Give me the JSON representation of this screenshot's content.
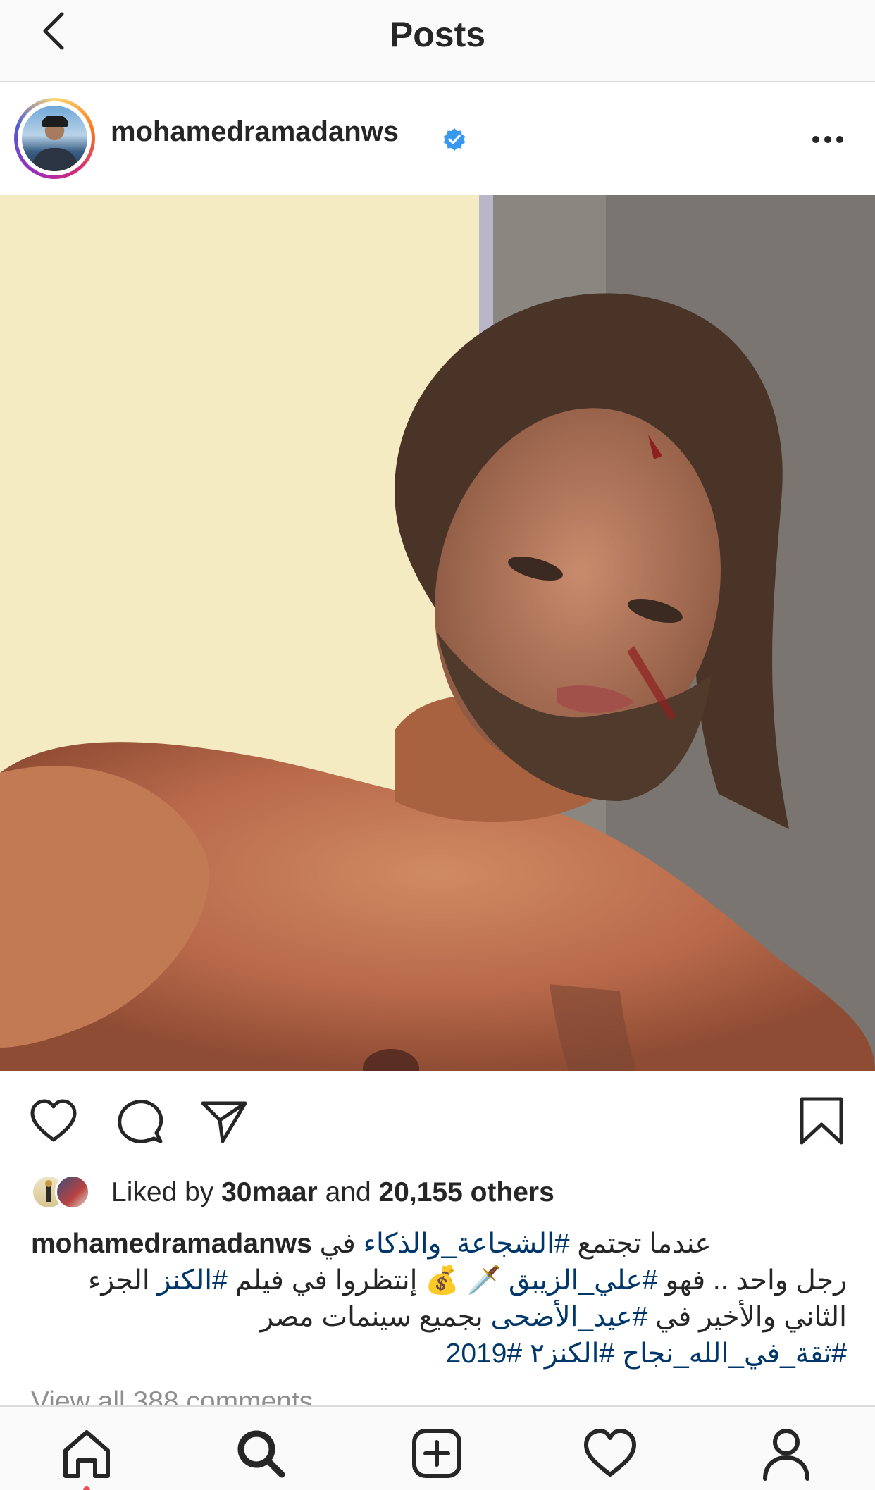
{
  "nav": {
    "title": "Posts"
  },
  "post": {
    "username": "mohamedramadanws",
    "verified": true,
    "image_description": "",
    "likes": {
      "prefix": "Liked by ",
      "first_user": "30maar",
      "middle": " and ",
      "others": "20,155 others"
    },
    "caption": {
      "user": "mohamedramadanws",
      "line1_text": "عندما تجتمع ",
      "line1_tag": "#الشجاعة_والذكاء",
      "line1_suffix": " في",
      "line2_a": "رجل واحد .. فهو ",
      "line2_tag1": "#علي_الزيبق",
      "line2_b": " 🗡️ 💰 إنتظروا في فيلم ",
      "line2_tag2": "#الكنز",
      "line2_c": " الجزء",
      "line3_a": "الثاني والأخير في ",
      "line3_tag": "#عيد_الأضحى",
      "line3_b": " بجميع سينمات مصر",
      "line4_tags": "#ثقة_في_الله_نجاح #الكنز٢ #2019"
    },
    "view_comments": "View all 388 comments"
  },
  "icons": {
    "back": "chevron-left-icon",
    "more": "more-horizontal-icon",
    "like": "heart-icon",
    "comment": "comment-icon",
    "share": "paper-plane-icon",
    "save": "bookmark-icon",
    "tabs": [
      "home-icon",
      "search-icon",
      "add-post-icon",
      "activity-heart-icon",
      "profile-icon"
    ]
  },
  "colors": {
    "verified": "#3897f0",
    "hashtag": "#00376b",
    "notification_dot": "#ed4956"
  }
}
